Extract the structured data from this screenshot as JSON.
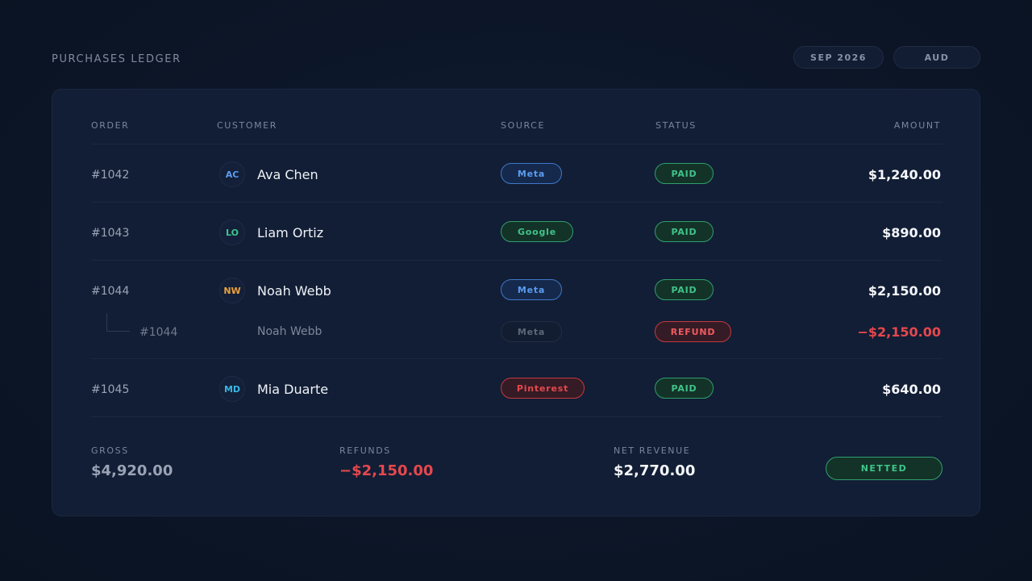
{
  "header": {
    "title": "PURCHASES LEDGER",
    "period": "SEP 2026",
    "currency": "AUD"
  },
  "table": {
    "columns": {
      "order": "ORDER",
      "customer": "CUSTOMER",
      "source": "SOURCE",
      "status": "STATUS",
      "amount": "AMOUNT"
    },
    "rows": [
      {
        "order": "#1042",
        "initials": "AC",
        "customer": "Ava Chen",
        "source": "Meta",
        "status": "PAID",
        "amount": "$1,240.00"
      },
      {
        "order": "#1043",
        "initials": "LO",
        "customer": "Liam Ortiz",
        "source": "Google",
        "status": "PAID",
        "amount": "$890.00"
      },
      {
        "order": "#1044",
        "initials": "NW",
        "customer": "Noah Webb",
        "source": "Meta",
        "status": "PAID",
        "amount": "$2,150.00",
        "refund": {
          "order": "#1044",
          "customer": "Noah Webb",
          "source": "Meta",
          "status": "REFUND",
          "amount": "−$2,150.00"
        }
      },
      {
        "order": "#1045",
        "initials": "MD",
        "customer": "Mia Duarte",
        "source": "Pinterest",
        "status": "PAID",
        "amount": "$640.00"
      }
    ]
  },
  "summary": {
    "gross_label": "GROSS",
    "gross_value": "$4,920.00",
    "refunds_label": "REFUNDS",
    "refunds_value": "−$2,150.00",
    "net_label": "NET REVENUE",
    "net_value": "$2,770.00",
    "badge": "NETTED"
  },
  "colors": {
    "meta": "#5b9cf0",
    "google": "#3fc48a",
    "pinterest": "#e5484d",
    "paid": "#3fc48a",
    "refund": "#e5484d",
    "avatar_ac": "#5b9cf0",
    "avatar_lo": "#3fc48a",
    "avatar_nw": "#e9a23b",
    "avatar_md": "#38b6e6"
  }
}
